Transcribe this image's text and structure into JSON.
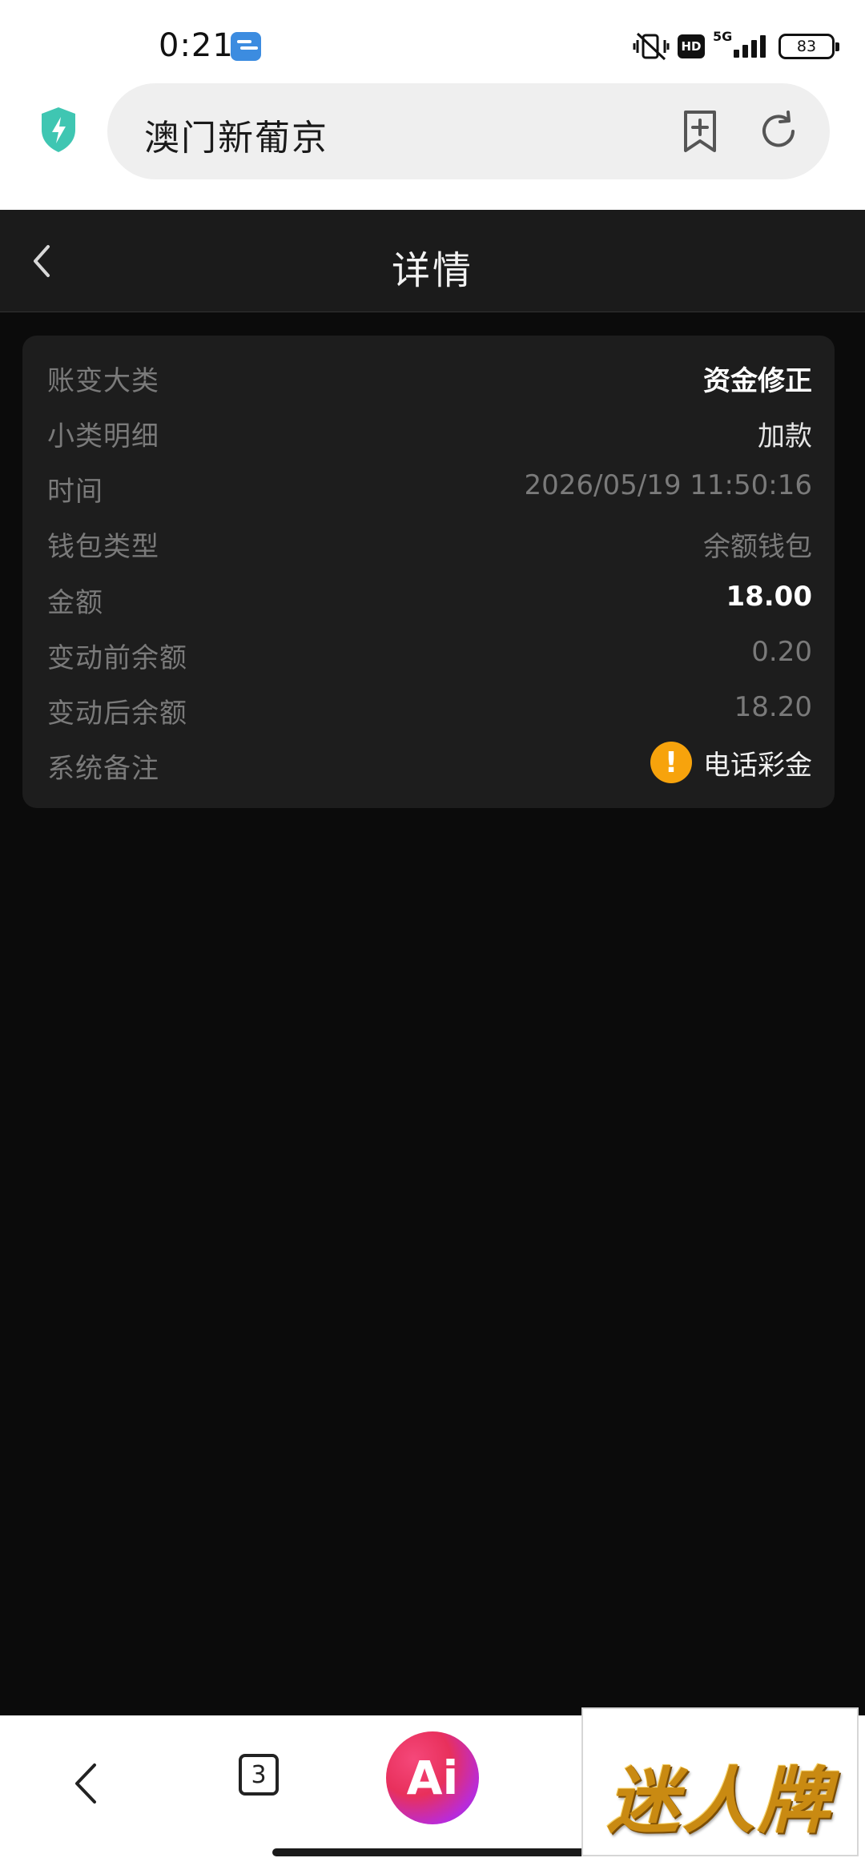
{
  "status_bar": {
    "time": "0:21",
    "network_label": "5G",
    "hd_label": "HD",
    "battery_level": "83"
  },
  "browser": {
    "url_text": "澳门新葡京",
    "icons": [
      "shield-bolt-icon",
      "bookmark-add-icon",
      "reload-icon"
    ]
  },
  "header": {
    "title": "详情",
    "back_icon": "chevron-left-icon"
  },
  "details": {
    "rows": [
      {
        "label": "账变大类",
        "value": "资金修正"
      },
      {
        "label": "小类明细",
        "value": "加款"
      },
      {
        "label": "时间",
        "value": "2026/05/19 11:50:16"
      },
      {
        "label": "钱包类型",
        "value": "余额钱包"
      },
      {
        "label": "金额",
        "value": "18.00"
      },
      {
        "label": "变动前余额",
        "value": "0.20"
      },
      {
        "label": "变动后余额",
        "value": "18.20"
      },
      {
        "label": "系统备注",
        "value": "电话彩金"
      }
    ],
    "warning_symbol": "!",
    "accent_color": "#f7a30c"
  },
  "bottom_nav": {
    "tab_count": "3",
    "ai_label": "Ai"
  },
  "overlay": {
    "brand_text": "迷人牌"
  }
}
